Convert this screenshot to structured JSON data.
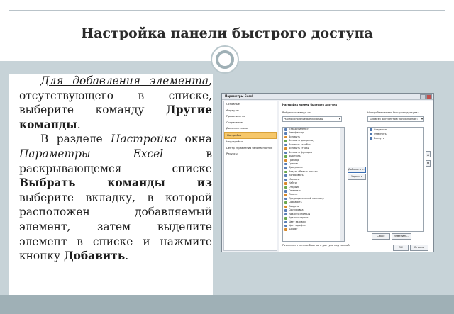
{
  "slide": {
    "title": "Настройка панели быстрого доступа",
    "paragraph1": {
      "link_text": "Для добавления элемента",
      "text1": ", отсутствующего в списке, выберите команду ",
      "bold1": "Другие команды",
      "text2": "."
    },
    "paragraph2": {
      "text1": "В разделе ",
      "italic1": "Настройка",
      "text2": " окна ",
      "italic2": "Параметры Excel",
      "text3": " в раскрывающемся списке ",
      "bold1": "Выбрать команды из",
      "text4": " выберите вкладку, в которой расположен добавляемый элемент, затем выделите элемент в списке и нажмите кнопку ",
      "bold2": "Добавить",
      "text5": "."
    }
  },
  "dialog": {
    "title": "Параметры Excel",
    "sidebar": [
      "Основные",
      "Формулы",
      "Правописание",
      "Сохранение",
      "Дополнительно",
      "Настройка",
      "Надстройки",
      "Центр управления безопасностью",
      "Ресурсы"
    ],
    "selected_index": 5,
    "header_text": "Настройка панели быстрого доступа",
    "choose_label": "Выбрать команды из:",
    "choose_value": "Часто используемые команды",
    "qa_label": "Настройка панели быстрого доступа:",
    "qa_value": "Для всех документов (по умолчанию)",
    "commands": [
      "<Разделитель>",
      "Автофильтр",
      "Вставить",
      "Вставить диаграмму",
      "Вставить столбцы",
      "Вставить строки",
      "Вставить функцию",
      "Вырезать",
      "Границы",
      "График",
      "Диаграмма",
      "Задать область печати",
      "Копировать",
      "Макросы",
      "Найти",
      "Открыть",
      "Отменить",
      "Печать",
      "Предварительный просмотр",
      "Сохранить",
      "Создать",
      "Сортировка",
      "Удалить столбцы",
      "Удалить строки",
      "Цвет заливки",
      "Цвет шрифта",
      "Шрифт"
    ],
    "qa_commands": [
      "Сохранить",
      "Отменить",
      "Вернуть"
    ],
    "add_button": "Добавить >>",
    "remove_button": "Удалить",
    "reset_button": "Сброс",
    "modify_button": "Изменить...",
    "show_below": "Разместить панель быстрого доступа под лентой",
    "ok_button": "ОК",
    "cancel_button": "Отмена"
  }
}
